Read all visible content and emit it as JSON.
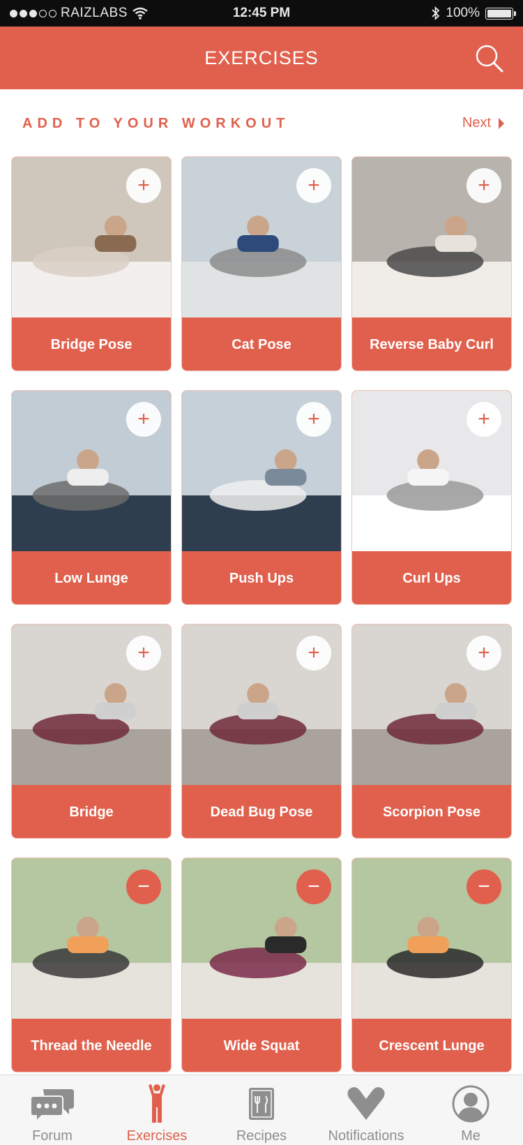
{
  "status_bar": {
    "carrier": "RAIZLABS",
    "time": "12:45 PM",
    "battery_text": "100%",
    "battery_level": 1.0
  },
  "header": {
    "title": "EXERCISES",
    "search_icon": "search-icon"
  },
  "section": {
    "title": "ADD TO YOUR WORKOUT",
    "next_label": "Next"
  },
  "colors": {
    "accent": "#e0604d",
    "tab_inactive": "#8e8e8e"
  },
  "exercises": [
    {
      "label": "Bridge Pose",
      "action": "+",
      "added": false
    },
    {
      "label": "Cat Pose",
      "action": "+",
      "added": false
    },
    {
      "label": "Reverse Baby Curl",
      "action": "+",
      "added": false
    },
    {
      "label": "Low Lunge",
      "action": "+",
      "added": false
    },
    {
      "label": "Push Ups",
      "action": "+",
      "added": false
    },
    {
      "label": "Curl Ups",
      "action": "+",
      "added": false
    },
    {
      "label": "Bridge",
      "action": "+",
      "added": false
    },
    {
      "label": "Dead Bug Pose",
      "action": "+",
      "added": false
    },
    {
      "label": "Scorpion Pose",
      "action": "+",
      "added": false
    },
    {
      "label": "Thread the Needle",
      "action": "−",
      "added": true
    },
    {
      "label": "Wide Squat",
      "action": "−",
      "added": true
    },
    {
      "label": "Crescent Lunge",
      "action": "−",
      "added": true
    }
  ],
  "tabs": [
    {
      "label": "Forum",
      "icon": "chat-bubbles-icon",
      "active": false
    },
    {
      "label": "Exercises",
      "icon": "person-icon",
      "active": true
    },
    {
      "label": "Recipes",
      "icon": "recipe-book-icon",
      "active": false
    },
    {
      "label": "Notifications",
      "icon": "heart-icon",
      "active": false
    },
    {
      "label": "Me",
      "icon": "profile-icon",
      "active": false
    }
  ]
}
